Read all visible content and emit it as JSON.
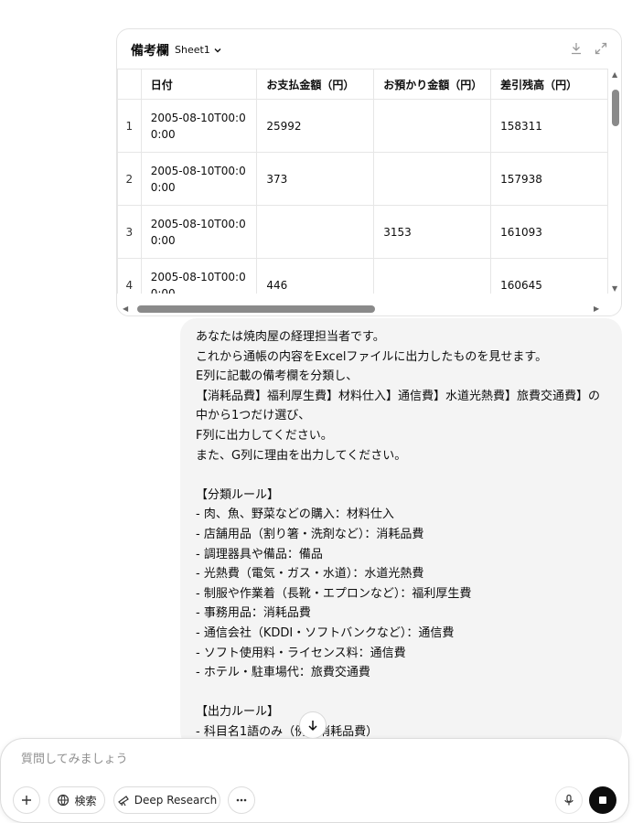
{
  "sheet": {
    "title": "備考欄",
    "sheet_name": "Sheet1",
    "columns": [
      "日付",
      "お支払金額（円）",
      "お預かり金額（円）",
      "差引残高（円）"
    ],
    "rows": [
      {
        "num": "1",
        "date": "2005-08-10T00:00:00",
        "payment": "25992",
        "deposit": "",
        "balance": "158311"
      },
      {
        "num": "2",
        "date": "2005-08-10T00:00:00",
        "payment": "373",
        "deposit": "",
        "balance": "157938"
      },
      {
        "num": "3",
        "date": "2005-08-10T00:00:00",
        "payment": "",
        "deposit": "3153",
        "balance": "161093"
      },
      {
        "num": "4",
        "date": "2005-08-10T00:00:00",
        "payment": "446",
        "deposit": "",
        "balance": "160645"
      }
    ]
  },
  "message": {
    "lines": [
      "あなたは焼肉屋の経理担当者です。",
      "これから通帳の内容をExcelファイルに出力したものを見せます。",
      "E列に記載の備考欄を分類し、",
      "【消耗品費】福利厚生費】材料仕入】通信費】水道光熱費】旅費交通費】の",
      "中から1つだけ選び、",
      "F列に出力してください。",
      "また、G列に理由を出力してください。",
      "",
      "【分類ルール】",
      "- 肉、魚、野菜などの購入：材料仕入",
      "- 店舗用品（割り箸・洗剤など）：消耗品費",
      "- 調理器具や備品：備品",
      "- 光熱費（電気・ガス・水道）：水道光熱費",
      "- 制服や作業着（長靴・エプロンなど）：福利厚生費",
      "- 事務用品：消耗品費",
      "- 通信会社（KDDI・ソフトバンクなど）：通信費",
      "- ソフト使用料・ライセンス料：通信費",
      "- ホテル・駐車場代：旅費交通費",
      "",
      "【出力ルール】",
      "- 科目名1語のみ（例：消耗品費）"
    ]
  },
  "composer": {
    "placeholder": "質問してみましょう",
    "search_label": "検索",
    "deep_research_label": "Deep Research"
  }
}
